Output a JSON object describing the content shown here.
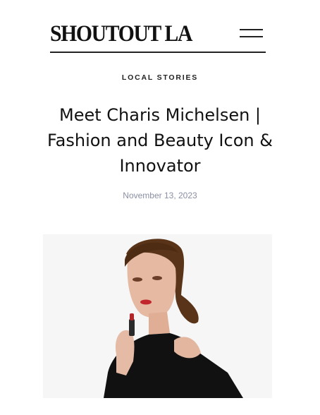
{
  "site": {
    "logo_text": "SHOUTOUT LA",
    "menu_icon": "hamburger-icon"
  },
  "article": {
    "category": "LOCAL STORIES",
    "title": "Meet Charis Michelsen | Fashion and Beauty Icon & Innovator",
    "date": "November 13, 2023"
  },
  "colors": {
    "text": "#111111",
    "date": "#8a8fa3",
    "lipstick": "#b3262a"
  }
}
